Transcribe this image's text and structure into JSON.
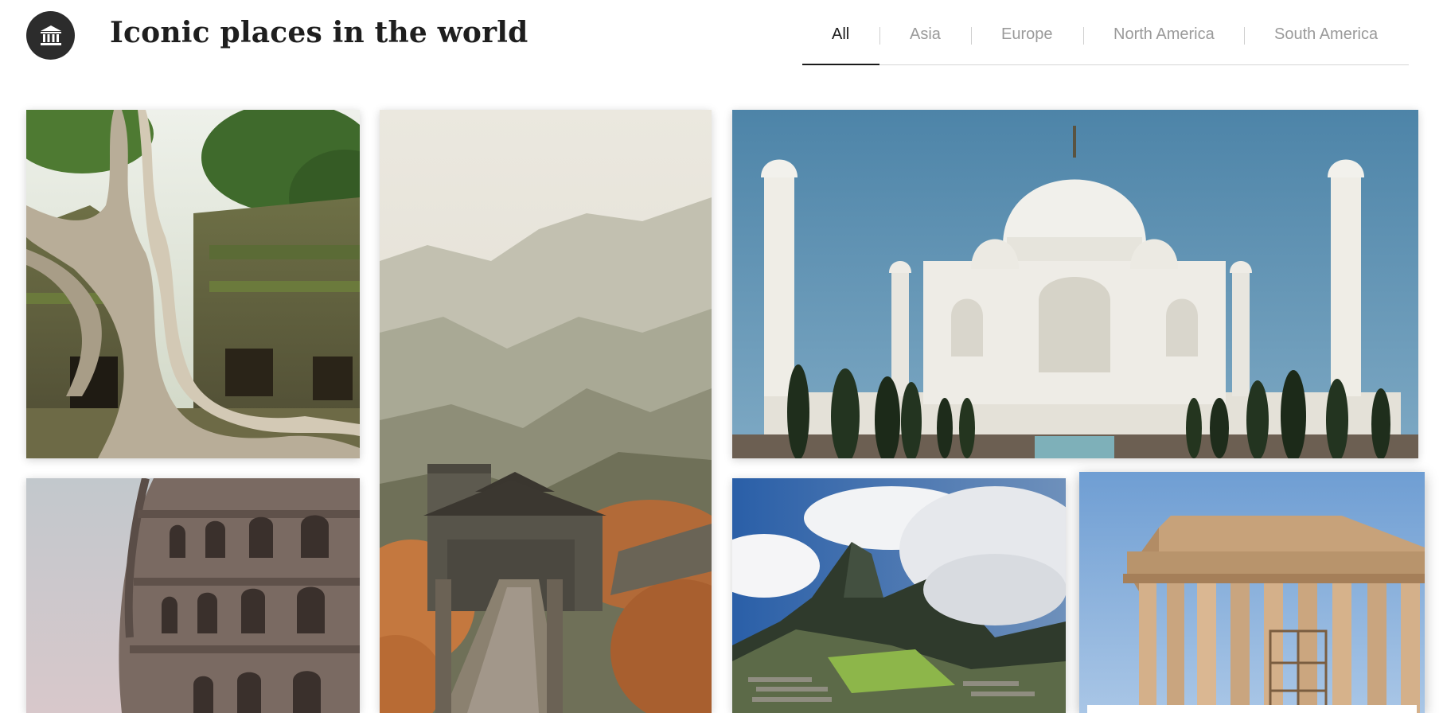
{
  "header": {
    "title": "Iconic places in the world",
    "logo_icon": "museum-icon"
  },
  "filters": {
    "tabs": [
      {
        "label": "All",
        "active": true
      },
      {
        "label": "Asia",
        "active": false
      },
      {
        "label": "Europe",
        "active": false
      },
      {
        "label": "North America",
        "active": false
      },
      {
        "label": "South America",
        "active": false
      }
    ]
  },
  "gallery": {
    "cards": [
      {
        "place": "Ta Prohm temple"
      },
      {
        "place": "Great Wall of China"
      },
      {
        "place": "Taj Mahal"
      },
      {
        "place": "Colosseum"
      },
      {
        "place": "Machu Picchu"
      },
      {
        "place": "Parthenon"
      }
    ]
  },
  "colors": {
    "text_primary": "#1e1e1e",
    "text_muted": "#9a9a9a",
    "logo_bg": "#2c2c2c"
  }
}
